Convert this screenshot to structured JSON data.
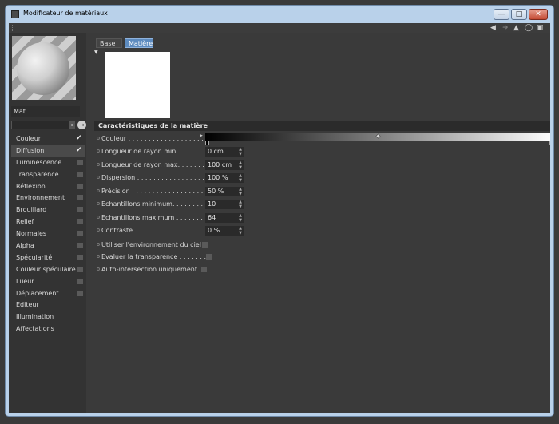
{
  "window": {
    "title": "Modificateur de matériaux"
  },
  "toolbar": {
    "icons": [
      "arrow-left-icon",
      "arrow-right-icon",
      "cursor-icon",
      "lock-icon",
      "new-window-icon"
    ]
  },
  "material": {
    "name": "Mat",
    "channels": [
      {
        "label": "Couleur",
        "checked": true
      },
      {
        "label": "Diffusion",
        "checked": true,
        "selected": true
      },
      {
        "label": "Luminescence",
        "checked": false
      },
      {
        "label": "Transparence",
        "checked": false
      },
      {
        "label": "Réflexion",
        "checked": false
      },
      {
        "label": "Environnement",
        "checked": false
      },
      {
        "label": "Brouillard",
        "checked": false
      },
      {
        "label": "Relief",
        "checked": false
      },
      {
        "label": "Normales",
        "checked": false
      },
      {
        "label": "Alpha",
        "checked": false
      },
      {
        "label": "Spécularité",
        "checked": false
      },
      {
        "label": "Couleur spéculaire",
        "checked": false
      },
      {
        "label": "Lueur",
        "checked": false
      },
      {
        "label": "Déplacement",
        "checked": false
      },
      {
        "label": "Editeur"
      },
      {
        "label": "Illumination"
      },
      {
        "label": "Affectations"
      }
    ]
  },
  "tabs": [
    {
      "label": "Base",
      "active": false
    },
    {
      "label": "Matière",
      "active": true
    }
  ],
  "section": {
    "title": "Caractéristiques de la matière"
  },
  "params": {
    "couleur": {
      "label": "Couleur . . . . . . . . . . . . . . . . . . . . . ."
    },
    "rows": [
      {
        "label": "Longueur de rayon min. . . . . . .",
        "value": "0 cm"
      },
      {
        "label": "Longueur de rayon max. . . . . . .",
        "value": "100 cm"
      },
      {
        "label": "Dispersion . . . . . . . . . . . . . . . . .",
        "value": "100 %"
      },
      {
        "label": "Précision . . . . . . . . . . . . . . . . . .",
        "value": "50 %"
      },
      {
        "label": "Echantillons minimum. . . . . . . .",
        "value": "10"
      },
      {
        "label": "Echantillons maximum . . . . . . .",
        "value": "64"
      },
      {
        "label": "Contraste . . . . . . . . . . . . . . . . . .",
        "value": "0 %"
      }
    ],
    "checks": [
      {
        "label": "Utiliser l'environnement du ciel",
        "checked": false
      },
      {
        "label": "Evaluer la transparence . . . . . . .",
        "checked": false
      },
      {
        "label": "Auto-intersection uniquement",
        "checked": false
      }
    ]
  },
  "colors": {
    "tab_active": "#5d8bbf",
    "panel": "#3a3a3a",
    "field": "#2a2a2a",
    "titlebar": "#b9d1ea"
  }
}
